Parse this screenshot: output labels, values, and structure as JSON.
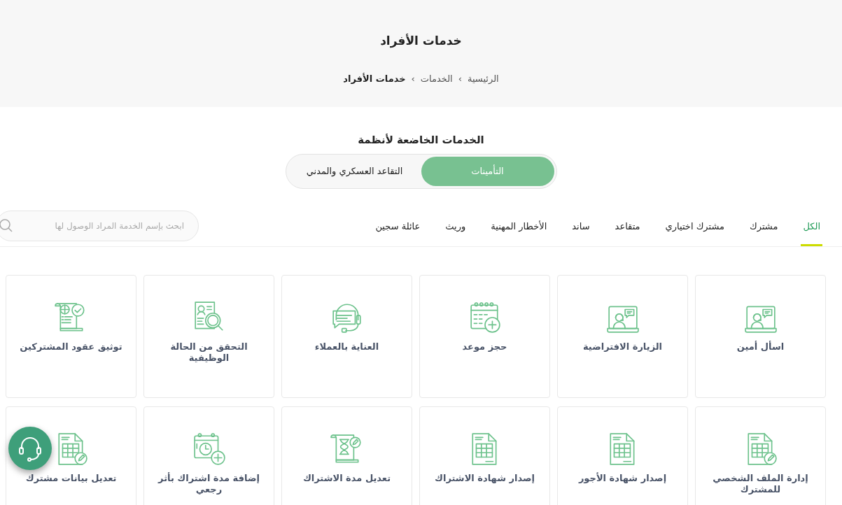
{
  "header": {
    "title": "خدمات الأفراد",
    "breadcrumb": [
      {
        "label": "الرئيسية",
        "current": false
      },
      {
        "label": "الخدمات",
        "current": false
      },
      {
        "label": "خدمات الأفراد",
        "current": true
      }
    ],
    "separator": "›"
  },
  "systems": {
    "title": "الخدمات الخاضعة لأنظمة",
    "options": [
      {
        "label": "التأمينات",
        "selected": true
      },
      {
        "label": "التقاعد العسكري والمدني",
        "selected": false
      }
    ]
  },
  "tabs": [
    {
      "label": "الكل",
      "selected": true
    },
    {
      "label": "مشترك",
      "selected": false
    },
    {
      "label": "مشترك اختياري",
      "selected": false
    },
    {
      "label": "متقاعد",
      "selected": false
    },
    {
      "label": "ساند",
      "selected": false
    },
    {
      "label": "الأخطار المهنية",
      "selected": false
    },
    {
      "label": "وريث",
      "selected": false
    },
    {
      "label": "عائلة سجين",
      "selected": false
    }
  ],
  "search": {
    "placeholder": "ابحث بإسم الخدمة المراد الوصول لها"
  },
  "services": [
    {
      "title": "اسأل أمين",
      "kind": "screen-agent"
    },
    {
      "title": "الزيارة الافتراضية",
      "kind": "screen-agent"
    },
    {
      "title": "حجز موعد",
      "kind": "calendar-plus"
    },
    {
      "title": "العناية بالعملاء",
      "kind": "headset-chat"
    },
    {
      "title": "التحقق من الحالة الوظيفية",
      "kind": "profile-search"
    },
    {
      "title": "توثيق عقود المشتركين",
      "kind": "contract-check"
    },
    {
      "title": "إدارة الملف الشخصي للمشترك",
      "kind": "sheet-edit"
    },
    {
      "title": "إصدار شهادة الأجور",
      "kind": "sheet"
    },
    {
      "title": "إصدار شهادة الاشتراك",
      "kind": "sheet"
    },
    {
      "title": "تعديل مدة الاشتراك",
      "kind": "scroll-hourglass"
    },
    {
      "title": "إضافة مدة اشتراك بأثر رجعي",
      "kind": "calendar-clock"
    },
    {
      "title": "تعديل بيانات مشترك",
      "kind": "sheet-edit"
    }
  ]
}
